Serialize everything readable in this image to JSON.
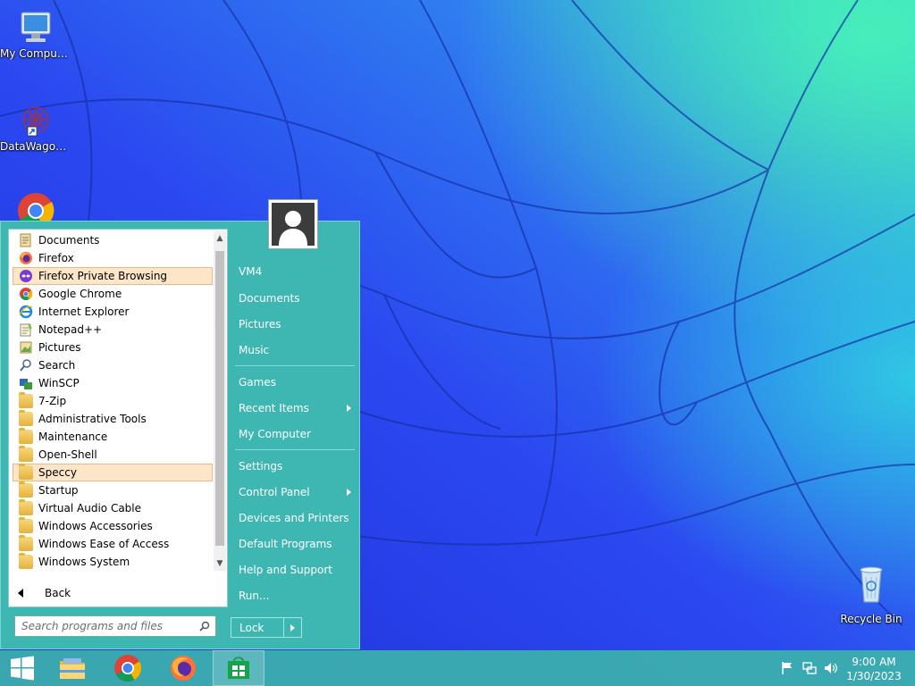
{
  "desktop": {
    "icons": [
      {
        "label": "My Computer",
        "icon": "computer-icon"
      },
      {
        "label": "DataWagon...",
        "icon": "datawagon-shortcut-icon"
      },
      {
        "label": "",
        "icon": "chrome-icon"
      },
      {
        "label": "Recycle Bin",
        "icon": "recycle-bin-icon"
      }
    ]
  },
  "start_menu": {
    "programs": [
      {
        "label": "Documents",
        "icon": "documents-icon",
        "highlighted": false
      },
      {
        "label": "Firefox",
        "icon": "firefox-icon",
        "highlighted": false
      },
      {
        "label": "Firefox Private Browsing",
        "icon": "firefox-private-icon",
        "highlighted": true
      },
      {
        "label": "Google Chrome",
        "icon": "chrome-icon",
        "highlighted": false
      },
      {
        "label": "Internet Explorer",
        "icon": "ie-icon",
        "highlighted": false
      },
      {
        "label": "Notepad++",
        "icon": "notepadpp-icon",
        "highlighted": false
      },
      {
        "label": "Pictures",
        "icon": "pictures-icon",
        "highlighted": false
      },
      {
        "label": "Search",
        "icon": "search-icon",
        "highlighted": false
      },
      {
        "label": "WinSCP",
        "icon": "winscp-icon",
        "highlighted": false
      },
      {
        "label": "7-Zip",
        "icon": "folder-icon",
        "highlighted": false
      },
      {
        "label": "Administrative Tools",
        "icon": "folder-icon",
        "highlighted": false
      },
      {
        "label": "Maintenance",
        "icon": "folder-icon",
        "highlighted": false
      },
      {
        "label": "Open-Shell",
        "icon": "folder-icon",
        "highlighted": false
      },
      {
        "label": "Speccy",
        "icon": "folder-icon",
        "highlighted": true
      },
      {
        "label": "Startup",
        "icon": "folder-icon",
        "highlighted": false
      },
      {
        "label": "Virtual Audio Cable",
        "icon": "folder-icon",
        "highlighted": false
      },
      {
        "label": "Windows Accessories",
        "icon": "folder-icon",
        "highlighted": false
      },
      {
        "label": "Windows Ease of Access",
        "icon": "folder-icon",
        "highlighted": false
      },
      {
        "label": "Windows System",
        "icon": "folder-icon",
        "highlighted": false
      }
    ],
    "back_label": "Back",
    "search_placeholder": "Search programs and files",
    "right_items": [
      {
        "label": "VM4",
        "submenu": false
      },
      {
        "label": "Documents",
        "submenu": false
      },
      {
        "label": "Pictures",
        "submenu": false
      },
      {
        "label": "Music",
        "submenu": false
      },
      {
        "label": "Games",
        "submenu": false
      },
      {
        "label": "Recent Items",
        "submenu": true
      },
      {
        "label": "My Computer",
        "submenu": false
      },
      {
        "label": "Settings",
        "submenu": false
      },
      {
        "label": "Control Panel",
        "submenu": true
      },
      {
        "label": "Devices and Printers",
        "submenu": false
      },
      {
        "label": "Default Programs",
        "submenu": false
      },
      {
        "label": "Help and Support",
        "submenu": false
      },
      {
        "label": "Run...",
        "submenu": false
      }
    ],
    "lock_label": "Lock"
  },
  "taskbar": {
    "buttons": [
      {
        "name": "start-button",
        "icon": "windows-logo-icon"
      },
      {
        "name": "file-explorer-button",
        "icon": "file-explorer-icon"
      },
      {
        "name": "chrome-button",
        "icon": "chrome-icon"
      },
      {
        "name": "firefox-button",
        "icon": "firefox-icon"
      },
      {
        "name": "store-button",
        "icon": "store-icon"
      }
    ],
    "tray_icons": [
      "flag-icon",
      "network-icon",
      "volume-icon"
    ],
    "clock": {
      "time": "9:00 AM",
      "date": "1/30/2023"
    }
  },
  "colors": {
    "start_menu_bg": "#3eb7b2",
    "highlight_bg": "#fde5c8",
    "taskbar_bg": "#3cb0ac"
  }
}
